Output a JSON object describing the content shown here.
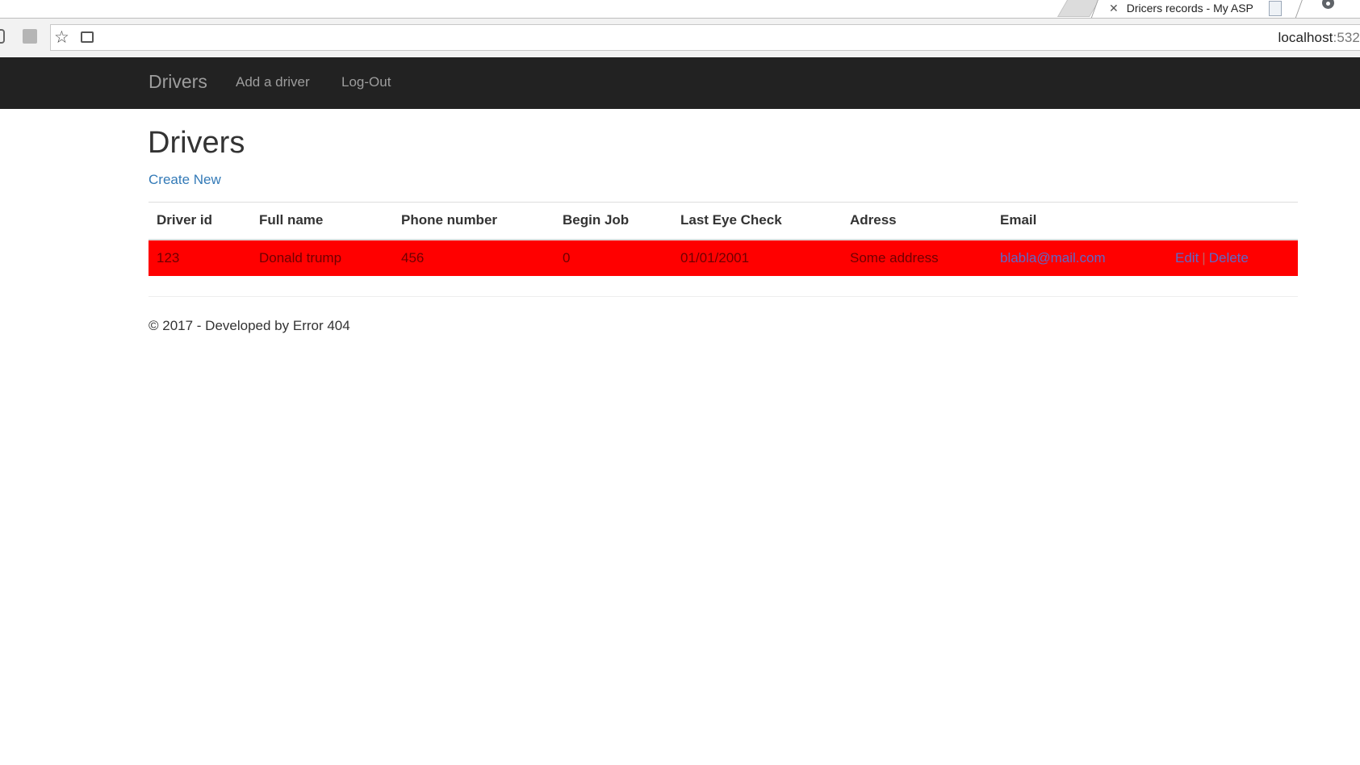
{
  "browser": {
    "tab_title": "Dricers records - My ASP",
    "tab_close_icon": "close-icon",
    "address_host": "localhost",
    "address_port": ":532"
  },
  "navbar": {
    "brand": "Drivers",
    "links": [
      "Add a driver",
      "Log-Out"
    ]
  },
  "main": {
    "title": "Drivers",
    "create_link": "Create New",
    "table": {
      "headers": [
        "Driver id",
        "Full name",
        "Phone number",
        "Begin Job",
        "Last Eye Check",
        "Adress",
        "Email"
      ],
      "rows": [
        {
          "driver_id": "123",
          "full_name": "Donald trump",
          "phone": "456",
          "begin_job": "0",
          "last_eye_check": "01/01/2001",
          "address": "Some address",
          "email": "blabla@mail.com",
          "edit": "Edit",
          "separator": "|",
          "delete": "Delete"
        }
      ],
      "highlight_color": "#ff0000"
    }
  },
  "footer": {
    "text": "© 2017 - Developed by Error 404"
  },
  "colors": {
    "navbar_bg": "#222222",
    "link": "#337ab7"
  }
}
